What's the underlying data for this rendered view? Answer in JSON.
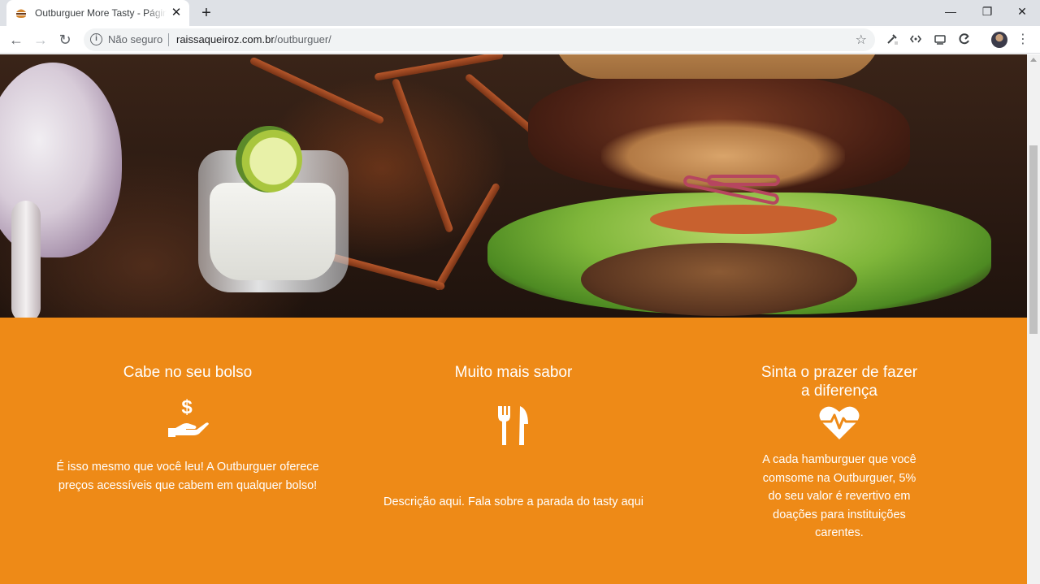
{
  "browser": {
    "tab_title": "Outburguer More Tasty - Página",
    "tab_close": "✕",
    "new_tab": "+",
    "window_controls": {
      "minimize": "—",
      "restore": "❐",
      "close": "✕"
    },
    "nav": {
      "back": "←",
      "forward": "→",
      "reload": "↻"
    },
    "security_icon": "i",
    "security_label": "Não seguro",
    "url_domain": "raissaqueiroz.com.br",
    "url_path": "/outburguer/",
    "bookmark_star": "☆",
    "menu": "⋮",
    "extensions": [
      "pipette-icon",
      "code-icon",
      "cast-icon",
      "refresh-ext-icon"
    ]
  },
  "features": [
    {
      "title": "Cabe no seu bolso",
      "icon": "money-hand-icon",
      "description": "É isso mesmo que você leu! A Outburguer oferece preços acessíveis que cabem em qualquer bolso!"
    },
    {
      "title": "Muito mais sabor",
      "icon": "cutlery-icon",
      "description": "Descrição aqui. Fala sobre a parada do tasty aqui"
    },
    {
      "title": "Sinta o prazer de fazer a diferença",
      "icon": "heart-pulse-icon",
      "description": "A cada hamburguer que você comsome na Outburguer, 5% do seu valor é revertivo em doações para instituições carentes."
    }
  ],
  "colors": {
    "accent": "#ee8a17",
    "text_on_accent": "#ffffff"
  }
}
